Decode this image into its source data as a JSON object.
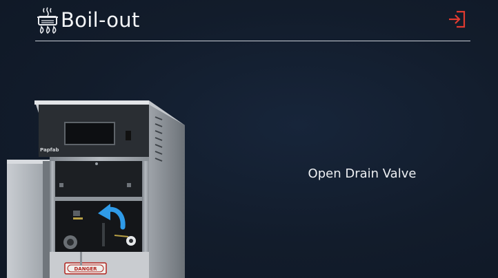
{
  "header": {
    "title": "Boil-out",
    "title_icon": "boil-pot-icon",
    "exit_icon": "exit-icon",
    "exit_color": "#e23b30"
  },
  "machine_image": {
    "brand": "Papfab",
    "warning_label": "DANGER",
    "arrow_color": "#2f9be8"
  },
  "step": {
    "instruction": "Open Drain Valve"
  }
}
